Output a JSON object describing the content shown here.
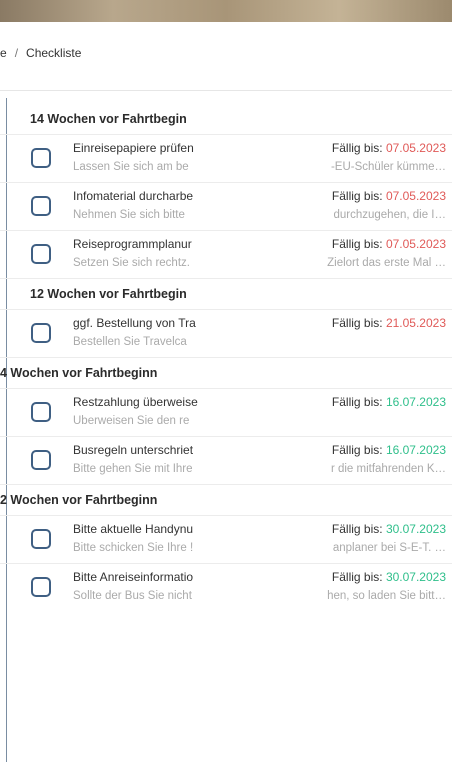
{
  "breadcrumb": {
    "prefix": "e",
    "separator": "/",
    "current": "Checkliste"
  },
  "groups": [
    {
      "heading": "14 Wochen vor Fahrtbegin",
      "tasks": [
        {
          "title": "Einreisepapiere prüfen",
          "desc": "Lassen Sie sich am be",
          "due_label": "Fällig bis:",
          "due_date": "07.05.2023",
          "due_status": "overdue",
          "desc2": "-EU-Schüler kümme…"
        },
        {
          "title": "Infomaterial durcharbe",
          "desc": "Nehmen Sie sich bitte",
          "due_label": "Fällig bis:",
          "due_date": "07.05.2023",
          "due_status": "overdue",
          "desc2": "durchzugehen, die I…"
        },
        {
          "title": "Reiseprogrammplanur",
          "desc": "Setzen Sie sich rechtz.",
          "due_label": "Fällig bis:",
          "due_date": "07.05.2023",
          "due_status": "overdue",
          "desc2": "Zielort das erste Mal …"
        }
      ]
    },
    {
      "heading": "12 Wochen vor Fahrtbegin",
      "tasks": [
        {
          "title": "ggf. Bestellung von Tra",
          "desc": "Bestellen Sie Travelca",
          "due_label": "Fällig bis:",
          "due_date": "21.05.2023",
          "due_status": "overdue",
          "desc2": ""
        }
      ]
    },
    {
      "heading": "4 Wochen vor Fahrtbeginn",
      "tasks": [
        {
          "title": "Restzahlung überweise",
          "desc": "Überweisen Sie den re",
          "due_label": "Fällig bis:",
          "due_date": "16.07.2023",
          "due_status": "upcoming",
          "desc2": ""
        },
        {
          "title": "Busregeln unterschriet",
          "desc": "Bitte gehen Sie mit Ihre",
          "due_label": "Fällig bis:",
          "due_date": "16.07.2023",
          "due_status": "upcoming",
          "desc2": "r die mitfahrenden K…"
        }
      ]
    },
    {
      "heading": "2 Wochen vor Fahrtbeginn",
      "tasks": [
        {
          "title": "Bitte aktuelle Handynu",
          "desc": "Bitte schicken Sie Ihre !",
          "due_label": "Fällig bis:",
          "due_date": "30.07.2023",
          "due_status": "upcoming",
          "desc2": "anplaner bei S-E-T. …"
        },
        {
          "title": "Bitte Anreiseinformatio",
          "desc": "Sollte der Bus Sie nicht",
          "due_label": "Fällig bis:",
          "due_date": "30.07.2023",
          "due_status": "upcoming",
          "desc2": "hen, so laden Sie bitt…"
        }
      ]
    }
  ],
  "colors": {
    "overdue": "#e05a58",
    "upcoming": "#2fbf8b",
    "checkbox_border": "#3f5f83"
  }
}
